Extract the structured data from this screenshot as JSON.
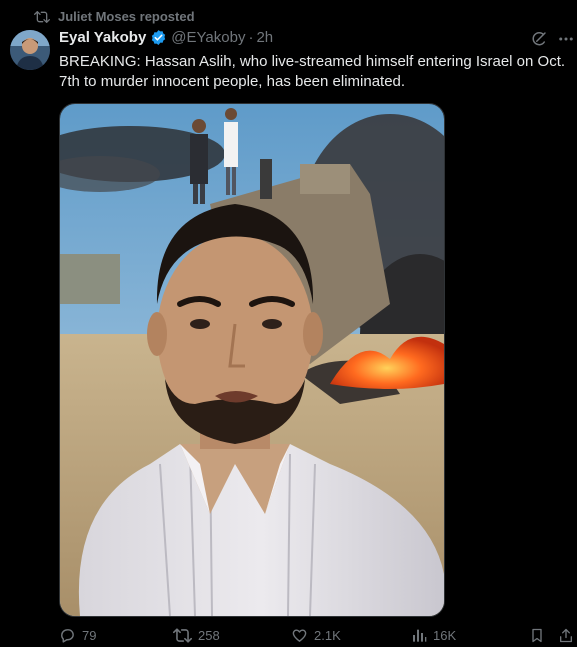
{
  "repost": {
    "label": "Juliet Moses reposted",
    "icon": "repost-icon"
  },
  "tweet": {
    "author_name": "Eyal Yakoby",
    "verified": true,
    "handle": "@EYakoby",
    "separator": "·",
    "time": "2h",
    "text": "BREAKING: Hassan Aslih, who live-streamed himself entering Israel on Oct. 7th to murder innocent people, has been eliminated."
  },
  "actions": {
    "replies": "79",
    "reposts": "258",
    "likes": "2.1K",
    "views": "16K"
  },
  "colors": {
    "background": "#000000",
    "text": "#e7e9ea",
    "muted": "#71767b",
    "verified": "#1d9bf0"
  }
}
